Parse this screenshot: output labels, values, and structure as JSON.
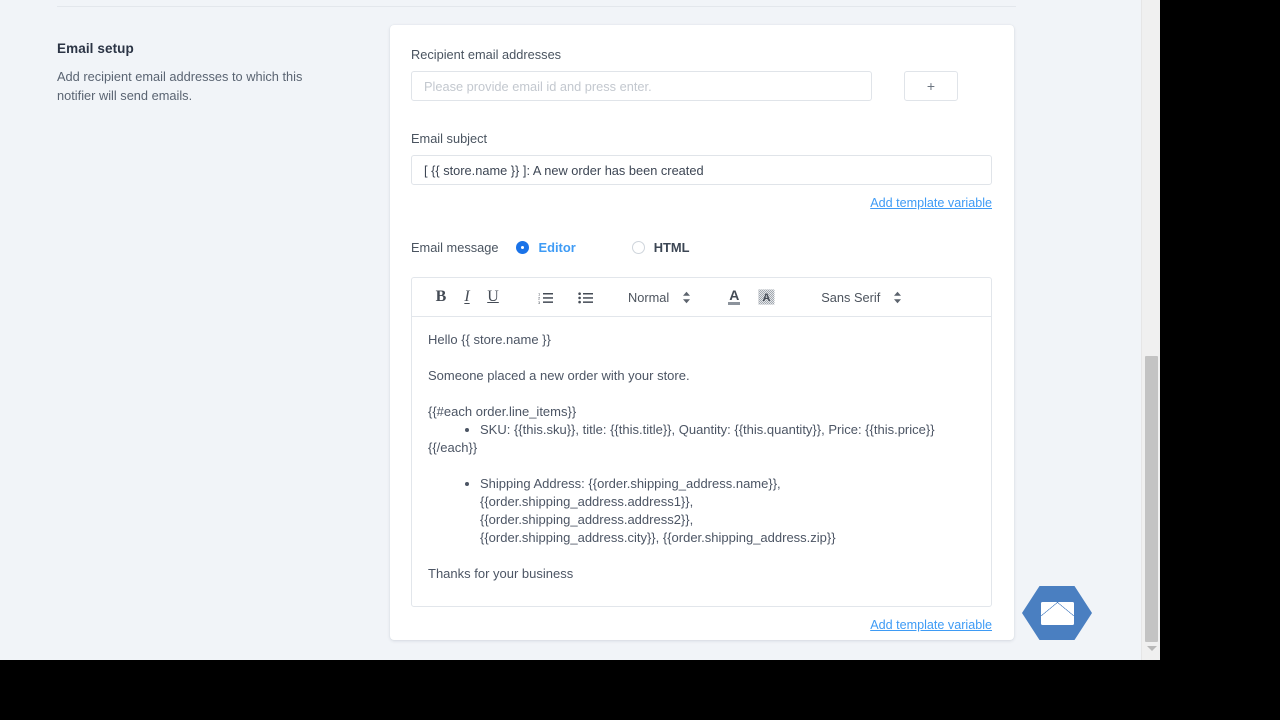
{
  "sidebar": {
    "title": "Email setup",
    "description": "Add recipient email addresses to which this notifier will send emails."
  },
  "form": {
    "recipient_label": "Recipient email addresses",
    "recipient_placeholder": "Please provide email id and press enter.",
    "recipient_value": "",
    "add_button_label": "+",
    "subject_label": "Email subject",
    "subject_value": "[ {{ store.name }} ]: A new order has been created",
    "add_template_variable_link": "Add template variable",
    "add_template_variable_link_bottom": "Add template variable"
  },
  "message_mode": {
    "label": "Email message",
    "options": [
      {
        "label": "Editor",
        "selected": true
      },
      {
        "label": "HTML",
        "selected": false
      }
    ]
  },
  "editor": {
    "toolbar": {
      "bold": "B",
      "italic": "I",
      "underline": "U",
      "ordered_list": "ordered-list-icon",
      "bullet_list": "bullet-list-icon",
      "heading_select": "Normal",
      "text_color": "A",
      "highlight_color": "A",
      "font_select": "Sans Serif"
    },
    "body": {
      "greeting": "Hello {{ store.name }}",
      "intro": "Someone placed a new order with your store.",
      "each_open": "{{#each order.line_items}}",
      "line_item_bullet": "SKU: {{this.sku}}, title: {{this.title}}, Quantity: {{this.quantity}}, Price: {{this.price}}",
      "each_close": "{{/each}}",
      "shipping_bullet_line1": "Shipping Address: {{order.shipping_address.name}},",
      "shipping_bullet_line2": "{{order.shipping_address.address1}},",
      "shipping_bullet_line3": "{{order.shipping_address.address2}},",
      "shipping_bullet_line4": "{{order.shipping_address.city}}, {{order.shipping_address.zip}}",
      "closing": "Thanks for your business"
    }
  },
  "floating_action": {
    "icon": "envelope-icon",
    "color": "#4a7fc1"
  },
  "colors": {
    "page_background": "#f1f4f8",
    "card_background": "#ffffff",
    "link": "#3e9bf5",
    "radio_selected": "#1a73e8",
    "border": "#e0e4e9"
  }
}
